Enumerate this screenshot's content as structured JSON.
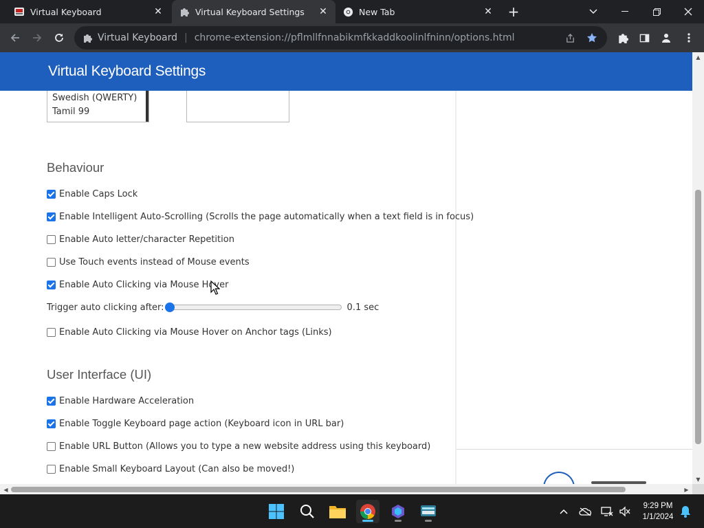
{
  "browser": {
    "tabs": [
      {
        "title": "Virtual Keyboard",
        "active": false
      },
      {
        "title": "Virtual Keyboard Settings",
        "active": true
      },
      {
        "title": "New Tab",
        "active": false
      }
    ],
    "new_tab_symbol": "+",
    "close_symbol": "✕",
    "omnibox": {
      "site_name": "Virtual Keyboard",
      "separator": "|",
      "url": "chrome-extension://pflmllfnnabikmfkkaddkoolinlfninn/options.html"
    },
    "accent_color": "#8ab4f8"
  },
  "page": {
    "header_title": "Virtual Keyboard Settings",
    "header_color": "#1e5fbd",
    "language_list": {
      "visible_items": [
        "Swedish (QWERTY)",
        "Tamil 99"
      ]
    },
    "behaviour": {
      "title": "Behaviour",
      "options": [
        {
          "label": "Enable Caps Lock",
          "checked": true
        },
        {
          "label": "Enable Intelligent Auto-Scrolling (Scrolls the page automatically when a text field is in focus)",
          "checked": true
        },
        {
          "label": "Enable Auto letter/character Repetition",
          "checked": false
        },
        {
          "label": "Use Touch events instead of Mouse events",
          "checked": false
        },
        {
          "label": "Enable Auto Clicking via Mouse Hover",
          "checked": true
        }
      ],
      "slider": {
        "label": "Trigger auto clicking after:",
        "value_text": "0.1 sec",
        "fraction": 0.0
      },
      "after_slider_option": {
        "label": "Enable Auto Clicking via Mouse Hover on Anchor tags (Links)",
        "checked": false
      }
    },
    "ui": {
      "title": "User Interface (UI)",
      "options": [
        {
          "label": "Enable Hardware Acceleration",
          "checked": true
        },
        {
          "label": "Enable Toggle Keyboard page action (Keyboard icon in URL bar)",
          "checked": true
        },
        {
          "label": "Enable URL Button (Allows you to type a new website address using this keyboard)",
          "checked": false
        },
        {
          "label": "Enable Small Keyboard Layout (Can also be moved!)",
          "checked": false
        }
      ]
    }
  },
  "taskbar": {
    "apps": [
      "start-icon",
      "search-icon",
      "file-explorer-icon",
      "chrome-icon",
      "copilot-icon",
      "virtual-keyboard-app-icon"
    ],
    "clock": {
      "time": "9:29 PM",
      "date": "1/1/2024"
    }
  }
}
